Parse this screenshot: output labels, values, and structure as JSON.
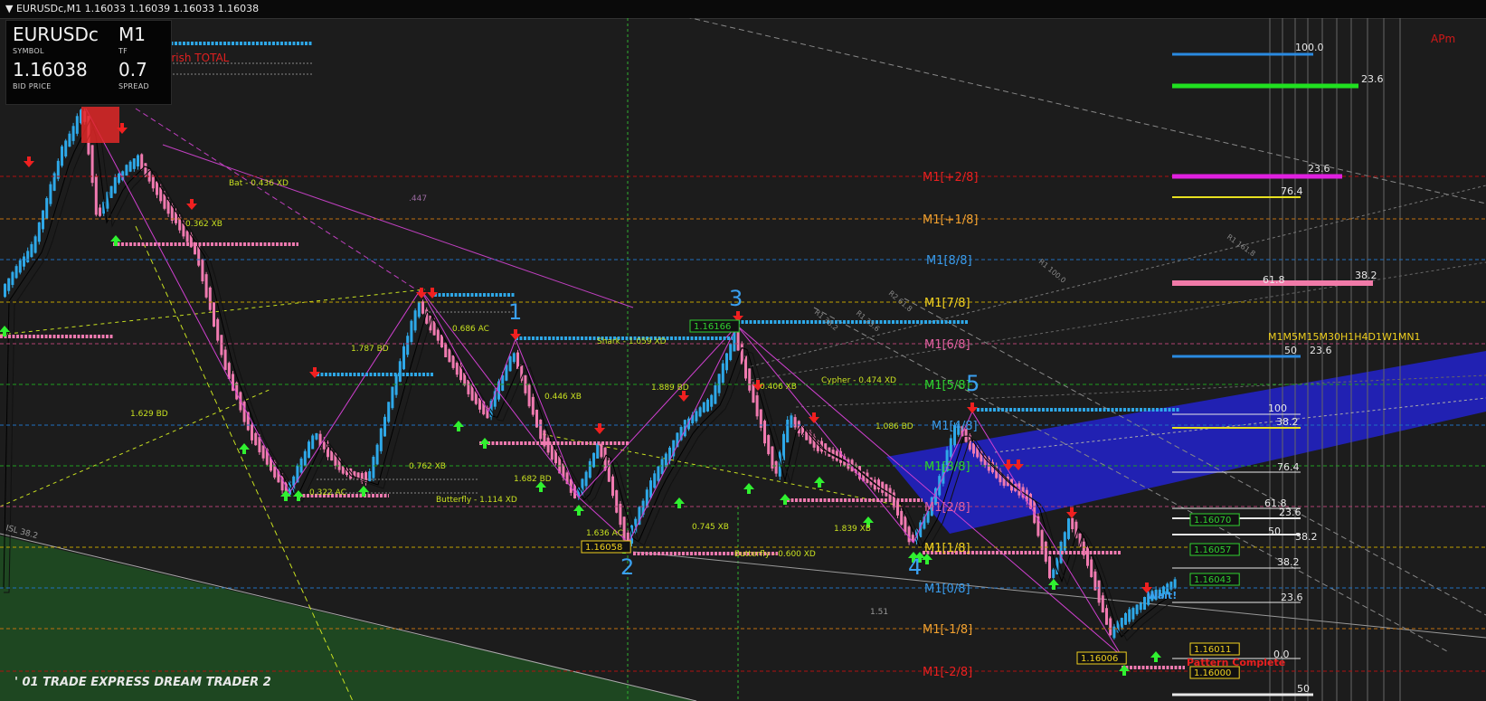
{
  "window": {
    "title": "EURUSDc,M1",
    "ohlc": "1.16033 1.16039 1.16033 1.16038"
  },
  "info_panel": {
    "symbol": "EURUSDc",
    "symbol_caption": "SYMBOL",
    "timeframe": "M1",
    "timeframe_caption": "TF",
    "bid": "1.16038",
    "bid_caption": "BID PRICE",
    "spread": "0.7",
    "spread_caption": "SPREAD"
  },
  "header_labels": {
    "bearish_total": "arish TOTAL",
    "apm": "APm",
    "brand": "' 01 TRADE EXPRESS DREAM TRADER 2"
  },
  "murrey_levels": [
    {
      "label": "M1[+2/8]",
      "color": "#e82020",
      "line": "#b01010"
    },
    {
      "label": "M1[+1/8]",
      "color": "#f0a030",
      "line": "#c07010"
    },
    {
      "label": "M1[8/8]",
      "color": "#3a9ae8",
      "line": "#2070c0"
    },
    {
      "label": "M1[7/8]",
      "color": "#f0d020",
      "line": "#c0a000"
    },
    {
      "label": "M1[6/8]",
      "color": "#e060a0",
      "line": "#b04070"
    },
    {
      "label": "M1[5/8]",
      "color": "#30d030",
      "line": "#20a020"
    },
    {
      "label": "M1[4/8]",
      "color": "#3a9ae8",
      "line": "#2070c0"
    },
    {
      "label": "M1[3/8]",
      "color": "#30d030",
      "line": "#20a020"
    },
    {
      "label": "M1[2/8]",
      "color": "#e060a0",
      "line": "#b04070"
    },
    {
      "label": "M1[1/8]",
      "color": "#f0d020",
      "line": "#c0a000"
    },
    {
      "label": "M1[0/8]",
      "color": "#3a9ae8",
      "line": "#2070c0"
    },
    {
      "label": "M1[-1/8]",
      "color": "#f0a030",
      "line": "#c07010"
    },
    {
      "label": "M1[-2/8]",
      "color": "#e82020",
      "line": "#b01010"
    }
  ],
  "wave_labels": [
    "1",
    "2",
    "3",
    "4",
    "5"
  ],
  "price_tags": {
    "wave3_high": "1.16166",
    "wave2_low": "1.16058",
    "right_1": "1.16070",
    "right_2": "1.16057",
    "right_3": "1.16043",
    "right_4": "1.16011",
    "right_5": "1.16000",
    "bottom_low": "1.16006"
  },
  "pattern_labels": [
    "Bat - 0.436 XD",
    "0.362 XB",
    ".447",
    "1.787 BD",
    "0.686 AC",
    "1.629 BD",
    "0.762 XB",
    "0.322 AC",
    "Butterfly - 1.114 XD",
    "1.682 BD",
    "0.446 XB",
    "Shark - 1.059 XD",
    "1.889 BD",
    "1.636 AC",
    "0.745 XB",
    "Butterfly - 0.600 XD",
    "0.406 XB",
    "Cypher - 0.474 XD",
    "1.086 BD",
    "1.839 XB",
    "1.51",
    "ISL 38.2",
    "Wait!",
    "Pattern Complete"
  ],
  "fib_levels_right": [
    {
      "label": "100.0",
      "color": "#2a8ae0"
    },
    {
      "label": "23.6",
      "color": "#20e020"
    },
    {
      "label": "23.6",
      "color": "#e020e0"
    },
    {
      "label": "76.4",
      "color": "#e8e020"
    },
    {
      "label": "61.8",
      "color": "#f07aa8"
    },
    {
      "label": "38.2",
      "color": "#f07aa8"
    },
    {
      "label": "50",
      "color": "#2a8ae0"
    },
    {
      "label": "23.6",
      "color": "#e8e8e8"
    },
    {
      "label": "100",
      "color": "#e8e8e8"
    },
    {
      "label": "38.2",
      "color": "#e8e020"
    },
    {
      "label": "76.4",
      "color": "#e8e8e8"
    },
    {
      "label": "61.8",
      "color": "#e8e8e8"
    },
    {
      "label": "23.6",
      "color": "#e8e8e8"
    },
    {
      "label": "50",
      "color": "#e8e8e8"
    },
    {
      "label": "38.2",
      "color": "#e8e8e8"
    },
    {
      "label": "38.2",
      "color": "#e8e8e8"
    },
    {
      "label": "23.6",
      "color": "#e8e8e8"
    },
    {
      "label": "0.0",
      "color": "#e8e8e8"
    },
    {
      "label": "50",
      "color": "#e8e8e8"
    }
  ],
  "timeframe_strip": "M1M5M15M30H1H4D1W1MN1",
  "diag_labels": [
    "R1 161.8",
    "R1 100.0",
    "R2 61.8",
    "R1 38.2",
    "R1 23.6"
  ],
  "colors": {
    "background": "#1c1c1c",
    "bull_candle": "#2ea8e8",
    "bear_candle": "#f07ab0",
    "arrow_up": "#30f030",
    "arrow_down": "#f02020",
    "channel": "#2222cc",
    "green_zone": "#1f4a22"
  }
}
